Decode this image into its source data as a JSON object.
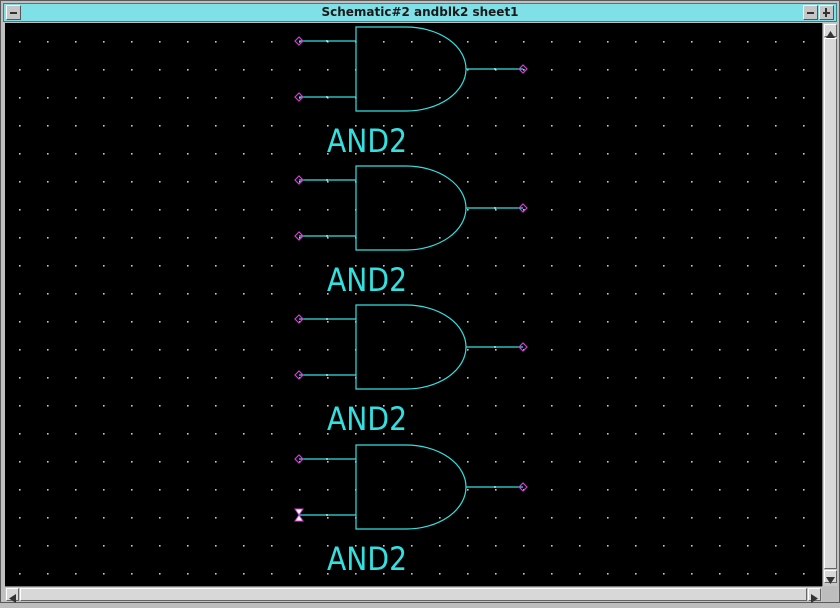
{
  "window": {
    "title": "Schematic#2 andblk2 sheet1"
  },
  "colors": {
    "background": "#000000",
    "grid_dot": "#c8c8c8",
    "wire": "#33e0e0",
    "pin": "#d040d0",
    "titlebar": "#7fe0e8"
  },
  "icons": {
    "window_menu": "minus-icon",
    "minimize": "minus-icon",
    "maximize": "plus-icon",
    "pin_marker": "diamond-icon",
    "pin_marker_selected": "hourglass-icon",
    "scroll_up": "triangle-up-icon",
    "scroll_down": "triangle-down-icon",
    "scroll_left": "triangle-left-icon",
    "scroll_right": "triangle-right-icon"
  },
  "schematic": {
    "gates": [
      {
        "label": "AND2"
      },
      {
        "label": "AND2"
      },
      {
        "label": "AND2"
      },
      {
        "label": "AND2"
      }
    ]
  }
}
